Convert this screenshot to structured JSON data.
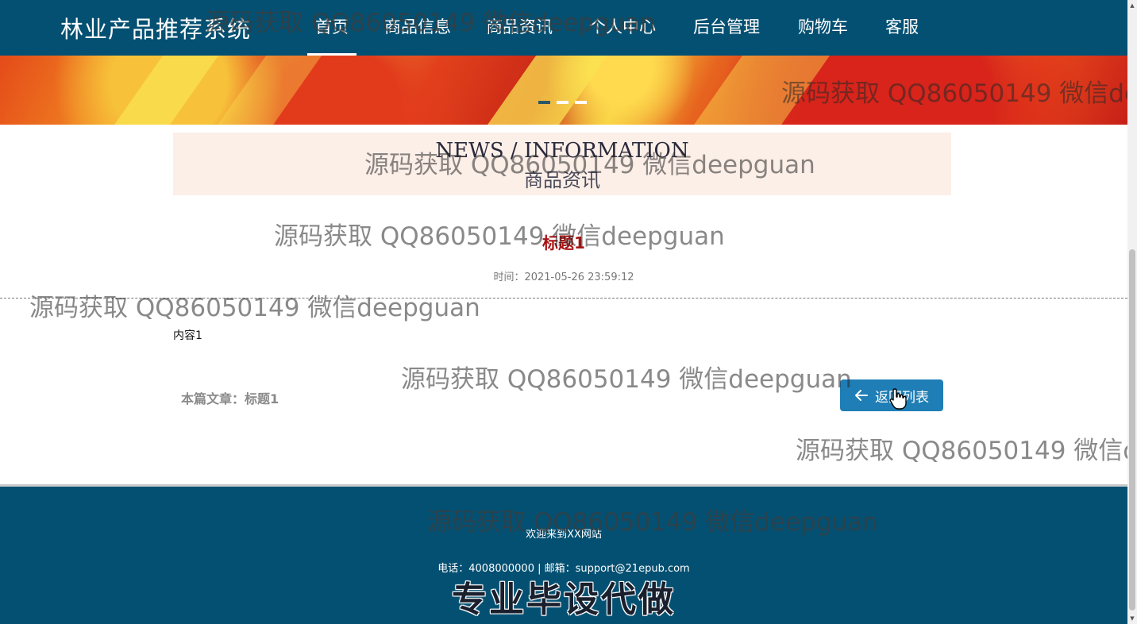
{
  "header": {
    "brand": "林业产品推荐系统",
    "nav": [
      {
        "label": "首页",
        "active": true
      },
      {
        "label": "商品信息",
        "active": false
      },
      {
        "label": "商品资讯",
        "active": false
      },
      {
        "label": "个人中心",
        "active": false
      },
      {
        "label": "后台管理",
        "active": false
      },
      {
        "label": "购物车",
        "active": false
      },
      {
        "label": "客服",
        "active": false
      }
    ]
  },
  "banner": {
    "slides": 3,
    "active_slide": 1
  },
  "section": {
    "title_en": "NEWS / INFORMATION",
    "title_cn": "商品资讯"
  },
  "article": {
    "title": "标题1",
    "time": "时间：2021-05-26 23:59:12",
    "content": "内容1",
    "current_label": "本篇文章：标题1",
    "back_button": "返回列表"
  },
  "footer": {
    "welcome": "欢迎来到XX网站",
    "contact": "电话：4008000000 | 邮箱：support@21epub.com",
    "slogan": "专业毕设代做"
  },
  "watermark": {
    "text": "源码获取 QQ86050149 微信deepguan"
  },
  "colors": {
    "primary": "#045072",
    "button": "#1f7eb6",
    "title_red": "#a81414",
    "section_bg": "#fcefe8"
  }
}
